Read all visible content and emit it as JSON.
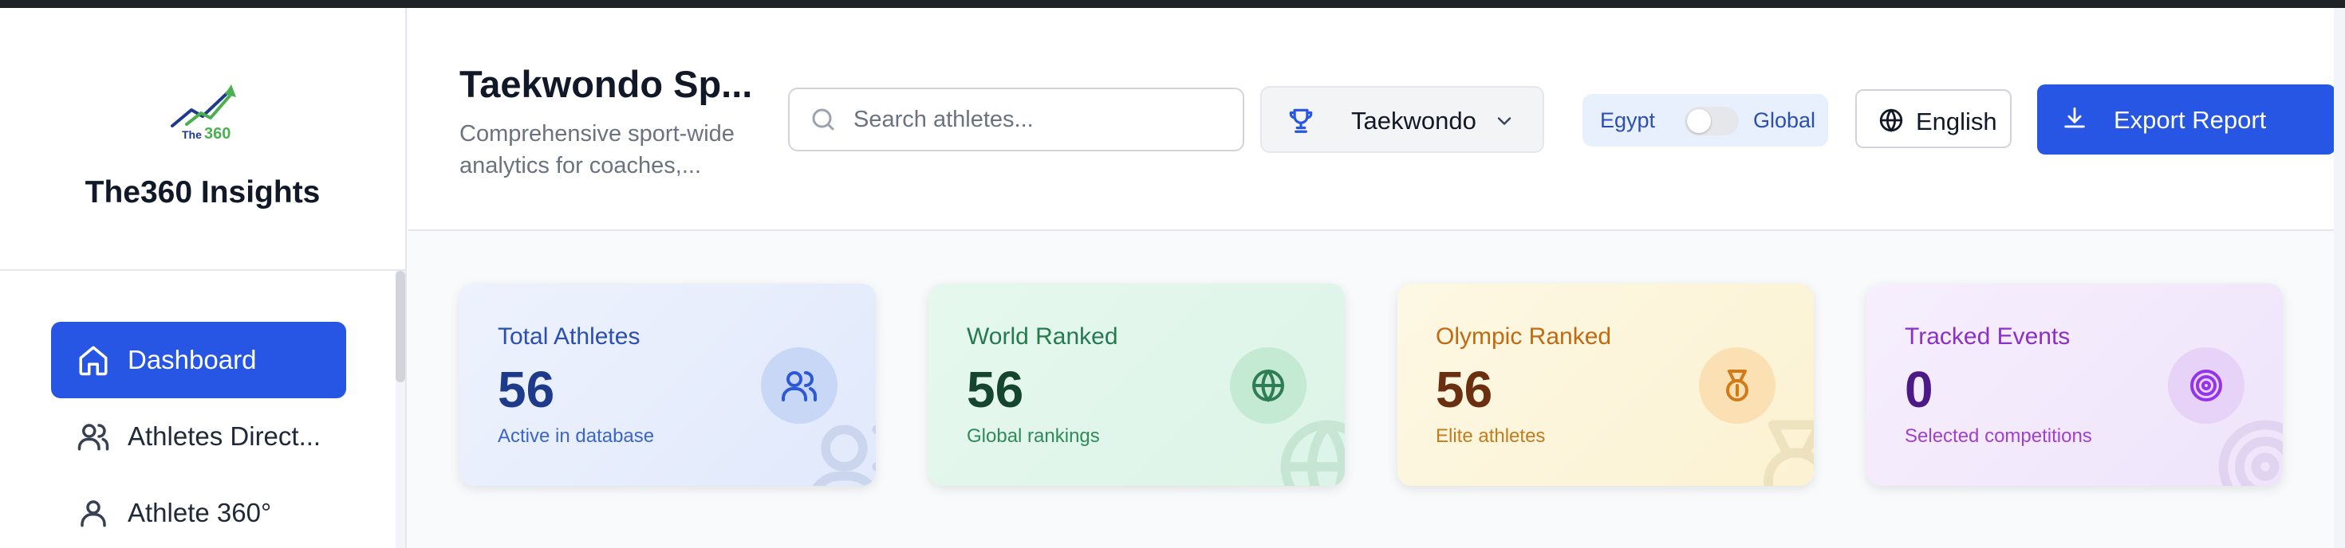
{
  "app": {
    "brand_name": "The360 Insights",
    "logo_text": "The360"
  },
  "sidebar": {
    "items": [
      {
        "label": "Dashboard",
        "icon": "home-icon",
        "active": true
      },
      {
        "label": "Athletes Direct...",
        "icon": "users-icon",
        "active": false
      },
      {
        "label": "Athlete 360°",
        "icon": "user-icon",
        "active": false
      }
    ]
  },
  "header": {
    "title": "Taekwondo Sp...",
    "subtitle": "Comprehensive sport-wide analytics for coaches,...",
    "search": {
      "placeholder": "Search athletes...",
      "value": ""
    },
    "sport_select": {
      "selected": "Taekwondo",
      "icon": "trophy-icon"
    },
    "scope_toggle": {
      "left": "Egypt",
      "right": "Global",
      "state": "Egypt"
    },
    "language": {
      "label": "English",
      "icon": "globe-icon"
    },
    "export": {
      "label": "Export Report",
      "icon": "download-icon"
    }
  },
  "stats": [
    {
      "title": "Total Athletes",
      "value": "56",
      "subtitle": "Active in database",
      "icon": "users-icon"
    },
    {
      "title": "World Ranked",
      "value": "56",
      "subtitle": "Global rankings",
      "icon": "globe-icon"
    },
    {
      "title": "Olympic Ranked",
      "value": "56",
      "subtitle": "Elite athletes",
      "icon": "medal-icon"
    },
    {
      "title": "Tracked Events",
      "value": "0",
      "subtitle": "Selected competitions",
      "icon": "target-icon"
    }
  ],
  "colors": {
    "primary": "#2656e3",
    "blue_card": "#e1e9fb",
    "green_card": "#dcf4e7",
    "yellow_card": "#fcf2d2",
    "purple_card": "#efe4fb"
  }
}
